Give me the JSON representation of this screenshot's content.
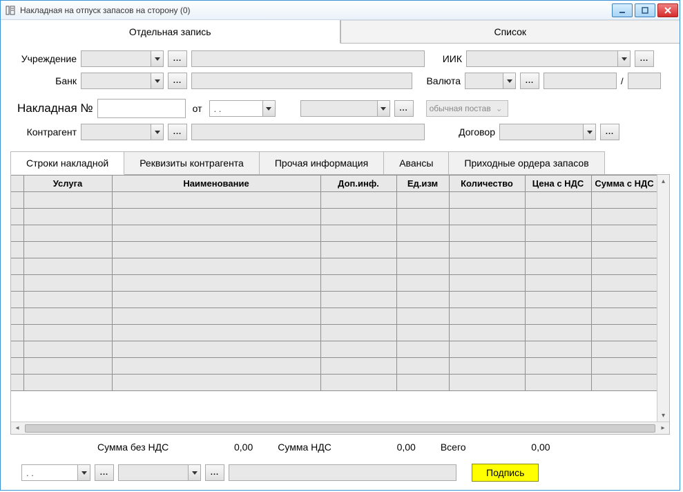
{
  "window": {
    "title": "Накладная на отпуск запасов на сторону (0)"
  },
  "topTabs": {
    "single": "Отдельная запись",
    "list": "Список"
  },
  "form": {
    "institution_label": "Учреждение",
    "bank_label": "Банк",
    "iik_label": "ИИК",
    "currency_label": "Валюта",
    "slash": "/",
    "invoice_label": "Накладная №",
    "from_label": "от",
    "date_placeholder": " .  .",
    "delivery_type": "обычная постав",
    "contractor_label": "Контрагент",
    "contract_label": "Договор"
  },
  "subTabs": {
    "lines": "Строки накладной",
    "requisites": "Реквизиты контрагента",
    "other": "Прочая информация",
    "advances": "Авансы",
    "receipts": "Приходные ордера запасов"
  },
  "grid": {
    "headers": {
      "service": "Услуга",
      "name": "Наименование",
      "extra": "Доп.инф.",
      "unit": "Ед.изм",
      "qty": "Количество",
      "price": "Цена с НДС",
      "sum": "Сумма с НДС"
    }
  },
  "totals": {
    "noVatLabel": "Сумма без НДС",
    "noVat": "0,00",
    "vatLabel": "Сумма НДС",
    "vat": "0,00",
    "totalLabel": "Всего",
    "total": "0,00"
  },
  "bottom": {
    "date_placeholder": " .  .",
    "sign": "Подпись"
  },
  "ellipsis": "..."
}
